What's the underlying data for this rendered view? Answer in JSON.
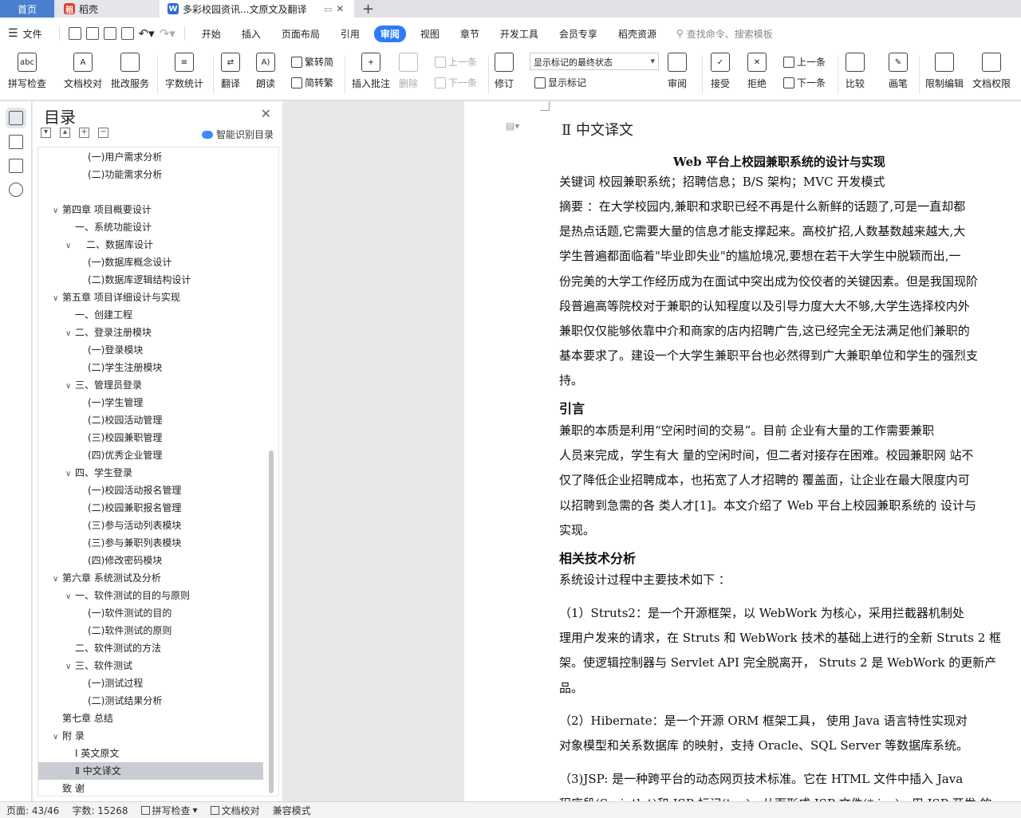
{
  "tabs": {
    "home": "首页",
    "daoke": "稻壳",
    "doc": "多彩校园资讯...文原文及翻译",
    "new_tab": "+"
  },
  "menu": {
    "file": "文件",
    "items": [
      "开始",
      "插入",
      "页面布局",
      "引用",
      "审阅",
      "视图",
      "章节",
      "开发工具",
      "会员专享",
      "稻壳资源"
    ],
    "search": "查找命令、搜索模板"
  },
  "ribbon": {
    "spell": "拼写检查",
    "proof": "文档校对",
    "batch": "批改服务",
    "wordcount": "字数统计",
    "translate": "翻译",
    "read": "朗读",
    "trad": "繁转简",
    "simp": "简转繁",
    "insert_comment": "插入批注",
    "delete": "删除",
    "prev1": "上一条",
    "next1": "下一条",
    "revise": "修订",
    "status_select": "显示标记的最终状态",
    "show_marks": "显示标记",
    "review": "审阅",
    "accept": "接受",
    "reject": "拒绝",
    "prev2": "上一条",
    "next2": "下一条",
    "compare": "比较",
    "pen": "画笔",
    "restrict": "限制编辑",
    "perm": "文档权限"
  },
  "toc": {
    "title": "目录",
    "smart": "智能识别目录",
    "items": [
      {
        "text": "(一)用户需求分析",
        "level": 3,
        "arrow": ""
      },
      {
        "text": "(二)功能需求分析",
        "level": 3,
        "arrow": ""
      },
      {
        "text": "",
        "level": 0,
        "arrow": ""
      },
      {
        "text": "第四章  项目概要设计",
        "level": 1,
        "arrow": "v"
      },
      {
        "text": "一、系统功能设计",
        "level": 2,
        "arrow": ""
      },
      {
        "text": "二、数据库设计",
        "level": 2,
        "arrow": "v",
        "indent_extra": true
      },
      {
        "text": "(一)数据库概念设计",
        "level": 3,
        "arrow": ""
      },
      {
        "text": "(二)数据库逻辑结构设计",
        "level": 3,
        "arrow": ""
      },
      {
        "text": "第五章  项目详细设计与实现",
        "level": 1,
        "arrow": "v"
      },
      {
        "text": "一、创建工程",
        "level": 2,
        "arrow": ""
      },
      {
        "text": "二、登录注册模块",
        "level": 2,
        "arrow": "v"
      },
      {
        "text": "(一)登录模块",
        "level": 3,
        "arrow": ""
      },
      {
        "text": "(二)学生注册模块",
        "level": 3,
        "arrow": ""
      },
      {
        "text": "三、管理员登录",
        "level": 2,
        "arrow": "v"
      },
      {
        "text": "(一)学生管理",
        "level": 3,
        "arrow": ""
      },
      {
        "text": "(二)校园活动管理",
        "level": 3,
        "arrow": ""
      },
      {
        "text": "(三)校园兼职管理",
        "level": 3,
        "arrow": ""
      },
      {
        "text": "(四)优秀企业管理",
        "level": 3,
        "arrow": ""
      },
      {
        "text": "四、学生登录",
        "level": 2,
        "arrow": "v"
      },
      {
        "text": "(一)校园活动报名管理",
        "level": 3,
        "arrow": ""
      },
      {
        "text": "(二)校园兼职报名管理",
        "level": 3,
        "arrow": ""
      },
      {
        "text": "(三)参与活动列表模块",
        "level": 3,
        "arrow": ""
      },
      {
        "text": "(三)参与兼职列表模块",
        "level": 3,
        "arrow": ""
      },
      {
        "text": "(四)修改密码模块",
        "level": 3,
        "arrow": ""
      },
      {
        "text": "第六章  系统测试及分析",
        "level": 1,
        "arrow": "v"
      },
      {
        "text": "一、软件测试的目的与原则",
        "level": 2,
        "arrow": "v"
      },
      {
        "text": "(一)软件测试的目的",
        "level": 3,
        "arrow": ""
      },
      {
        "text": "(二)软件测试的原则",
        "level": 3,
        "arrow": ""
      },
      {
        "text": "二、软件测试的方法",
        "level": 2,
        "arrow": ""
      },
      {
        "text": "三、软件测试",
        "level": 2,
        "arrow": "v"
      },
      {
        "text": "(一)测试过程",
        "level": 3,
        "arrow": ""
      },
      {
        "text": "(二)测试结果分析",
        "level": 3,
        "arrow": ""
      },
      {
        "text": "第七章  总结",
        "level": 1,
        "arrow": ""
      },
      {
        "text": "附    录",
        "level": 1,
        "arrow": "v"
      },
      {
        "text": "Ⅰ  英文原文",
        "level": 2,
        "arrow": ""
      },
      {
        "text": "Ⅱ  中文译文",
        "level": 2,
        "arrow": "",
        "selected": true
      },
      {
        "text": "致    谢",
        "level": 1,
        "arrow": ""
      }
    ]
  },
  "doc": {
    "section_title": "Ⅱ  中文译文",
    "paper_title": "Web 平台上校园兼职系统的设计与实现",
    "keywords": "关键词  校园兼职系统；招聘信息；B/S 架构；MVC 开发模式",
    "abstract_lines": [
      "摘要  ：在大学校园内,兼职和求职已经不再是什么新鲜的话题了,可是一直却都",
      "是热点话题,它需要大量的信息才能支撑起来。高校扩招,人数基数越来越大,大",
      "学生普遍都面临着\"毕业即失业\"的尴尬境况,要想在若干大学生中脱颖而出,一",
      "份完美的大学工作经历成为在面试中突出成为佼佼者的关键因素。但是我国现阶",
      "段普遍高等院校对于兼职的认知程度以及引导力度大大不够,大学生选择校内外",
      "兼职仅仅能够依靠中介和商家的店内招聘广告,这已经完全无法满足他们兼职的",
      "基本要求了。建设一个大学生兼职平台也必然得到广大兼职单位和学生的强烈支",
      "持。"
    ],
    "intro_heading": "引言",
    "intro_lines": [
      "    兼职的本质是利用“空闲时间的交易”。目前 企业有大量的工作需要兼职",
      "人员来完成，学生有大  量的空闲时间，但二者对接存在困难。校园兼职网  站不",
      "仅了降低企业招聘成本，也拓宽了人才招聘的  覆盖面，让企业在最大限度内可",
      "以招聘到急需的各  类人才[1]。本文介绍了 Web 平台上校园兼职系统的  设计与",
      "实现。"
    ],
    "tech_heading": "相关技术分析",
    "tech_intro": "    系统设计过程中主要技术如下  ：",
    "struts_lines": [
      "    （1）Struts2：是一个开源框架，以  WebWork 为核心，采用拦截器机制处",
      "理用户发来的请求，在  Struts 和 WebWork 技术的基础上进行的全新 Struts 2  框",
      "架。使逻辑控制器与  Servlet API  完全脱离开，   Struts 2  是  WebWork  的更新产",
      "品。"
    ],
    "hibernate_lines": [
      "    （2）Hibernate：是一个开源  ORM  框架工具，  使用  Java  语言特性实现对",
      "对象模型和关系数据库  的映射，支持  Oracle、SQL Server  等数据库系统。"
    ],
    "jsp_lines": [
      "    （3)JSP:  是一种跨平台的动态网页技术标准。它在 HTML 文件中插入 Java",
      "程序段(Scriptlet)和 JSP 标记(tag)，从而形成  JSP 文件(*.jsp)。用  JSP 开发  的"
    ]
  },
  "status": {
    "page": "页面: 43/46",
    "words": "字数: 15268",
    "spell": "拼写检查",
    "proof": "文档校对",
    "compat": "兼容模式"
  },
  "colors": {
    "accent": "#2e7cf6",
    "home_tab": "#4a7fd0",
    "selection": "#c9cdd3"
  }
}
